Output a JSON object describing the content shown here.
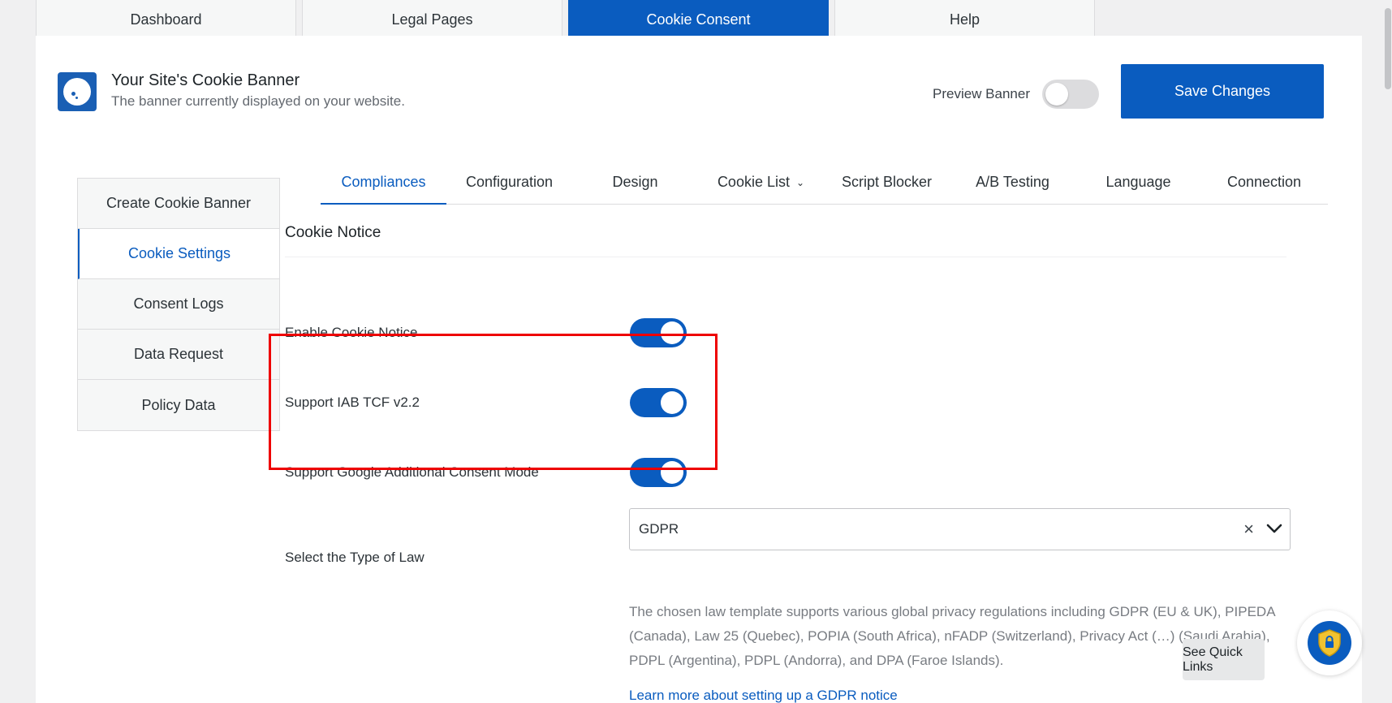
{
  "top_tabs": [
    {
      "label": "Dashboard"
    },
    {
      "label": "Legal Pages"
    },
    {
      "label": "Cookie Consent"
    },
    {
      "label": "Help"
    }
  ],
  "header": {
    "title": "Your Site's Cookie Banner",
    "subtitle": "The banner currently displayed on your website.",
    "preview_label": "Preview Banner",
    "preview_enabled": false,
    "save_label": "Save Changes"
  },
  "sidebar": {
    "items": [
      {
        "label": "Create Cookie Banner"
      },
      {
        "label": "Cookie Settings"
      },
      {
        "label": "Consent Logs"
      },
      {
        "label": "Data Request"
      },
      {
        "label": "Policy Data"
      }
    ]
  },
  "sub_tabs": [
    {
      "label": "Compliances"
    },
    {
      "label": "Configuration"
    },
    {
      "label": "Design"
    },
    {
      "label": "Cookie List"
    },
    {
      "label": "Script Blocker"
    },
    {
      "label": "A/B Testing"
    },
    {
      "label": "Language"
    },
    {
      "label": "Connection"
    }
  ],
  "cookie_notice": {
    "title": "Cookie Notice",
    "rows": [
      {
        "label": "Enable Cookie Notice",
        "enabled": true
      },
      {
        "label": "Support IAB TCF v2.2",
        "enabled": true
      },
      {
        "label": "Support Google Additional Consent Mode",
        "enabled": true
      }
    ]
  },
  "law": {
    "label": "Select the Type of Law",
    "value": "GDPR",
    "description": "The chosen law template supports various global privacy regulations including GDPR (EU & UK), PIPEDA (Canada), Law 25 (Quebec), POPIA (South Africa), nFADP (Switzerland), Privacy Act (…) (Saudi Arabia), PDPL (Argentina), PDPL (Andorra), and DPA (Faroe Islands).",
    "learn_more": "Learn more about setting up a GDPR notice"
  },
  "quick_links_label": "See Quick Links",
  "colors": {
    "accent": "#0a5cbf",
    "highlight": "#ee0000"
  }
}
